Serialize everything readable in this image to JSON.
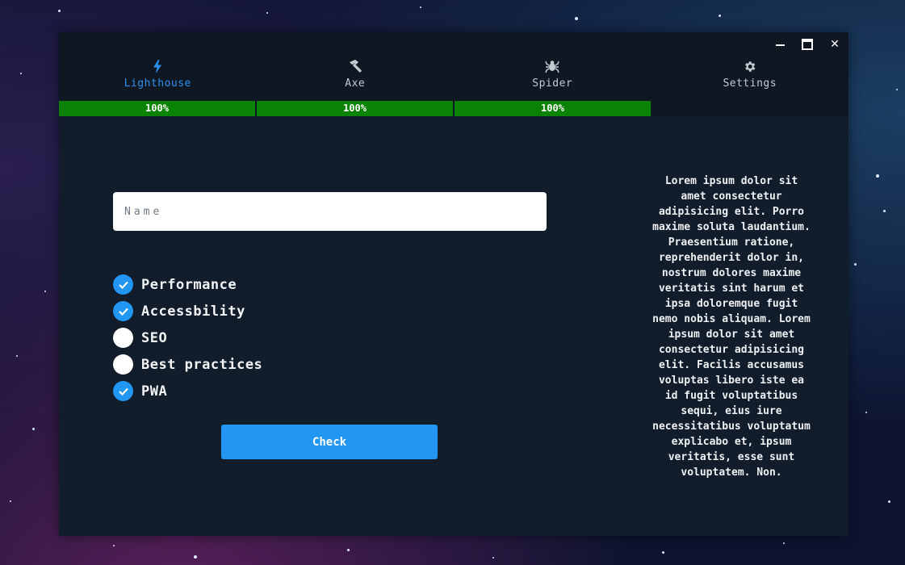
{
  "window": {
    "controls": {
      "minimize": "minimize",
      "maximize": "maximize",
      "close": "✕"
    }
  },
  "tabs": [
    {
      "label": "Lighthouse",
      "icon": "lightning-bolt-icon",
      "active": true
    },
    {
      "label": "Axe",
      "icon": "hammer-icon",
      "active": false
    },
    {
      "label": "Spider",
      "icon": "spider-icon",
      "active": false
    },
    {
      "label": "Settings",
      "icon": "gear-icon",
      "active": false
    }
  ],
  "progress": [
    {
      "value": 1.0,
      "text": "100%"
    },
    {
      "value": 1.0,
      "text": "100%"
    },
    {
      "value": 1.0,
      "text": "100%"
    }
  ],
  "form": {
    "name_placeholder": "Name",
    "name_value": "",
    "options": [
      {
        "label": "Performance",
        "checked": true
      },
      {
        "label": "Accessbility",
        "checked": true
      },
      {
        "label": "SEO",
        "checked": false
      },
      {
        "label": "Best practices",
        "checked": false
      },
      {
        "label": "PWA",
        "checked": true
      }
    ],
    "check_button_label": "Check"
  },
  "side_text": "Lorem ipsum dolor sit amet consectetur adipisicing elit. Porro maxime soluta laudantium. Praesentium ratione, reprehenderit dolor in, nostrum dolores maxime veritatis sint harum et ipsa doloremque fugit nemo nobis aliquam. Lorem ipsum dolor sit amet consectetur adipisicing elit. Facilis accusamus voluptas libero iste ea id fugit voluptatibus sequi, eius iure necessitatibus voluptatum explicabo et, ipsum veritatis, esse sunt voluptatem. Non.",
  "colors": {
    "accent": "#2196f3",
    "progress": "#0a8203",
    "window_bg": "#121d2b",
    "titlebar_bg": "#0f1822"
  }
}
